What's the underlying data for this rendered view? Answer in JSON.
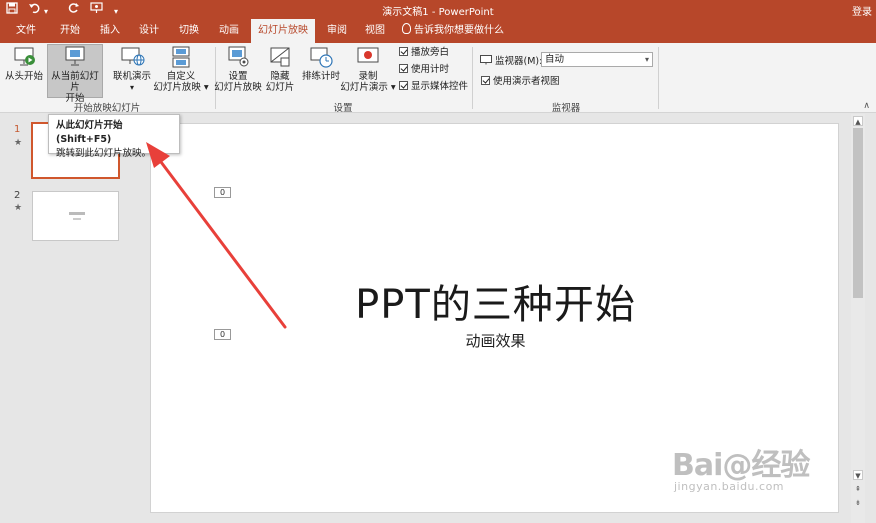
{
  "titlebar": {
    "title": "演示文稿1  -  PowerPoint",
    "login": "登录",
    "quick_access": {
      "save": "save-icon",
      "undo": "undo-icon",
      "redo": "redo-icon",
      "from_start": "from-start-icon",
      "customize": "▾"
    }
  },
  "tabs": [
    {
      "label": "文件"
    },
    {
      "label": "开始"
    },
    {
      "label": "插入"
    },
    {
      "label": "设计"
    },
    {
      "label": "切换"
    },
    {
      "label": "动画"
    },
    {
      "label": "幻灯片放映"
    },
    {
      "label": "审阅"
    },
    {
      "label": "视图"
    }
  ],
  "tell_me": "告诉我你想要做什么",
  "ribbon": {
    "start_slideshow_group": {
      "label": "开始放映幻灯片",
      "from_beginning": "从头开始",
      "from_current_line1": "从当前幻灯片",
      "from_current_line2": "开始",
      "online_line1": "联机演示",
      "custom_line1": "自定义",
      "custom_line2": "幻灯片放映 ▾"
    },
    "setup_group": {
      "label": "设置",
      "setup_line1": "设置",
      "setup_line2": "幻灯片放映",
      "hide_line1": "隐藏",
      "hide_line2": "幻灯片",
      "rehearse": "排练计时",
      "record_line1": "录制",
      "record_line2": "幻灯片演示 ▾",
      "play_narrations": "播放旁白",
      "use_timings": "使用计时",
      "show_media_controls": "显示媒体控件"
    },
    "monitors_group": {
      "label": "监视器",
      "monitor_label": "监视器(M):",
      "monitor_value": "自动",
      "use_presenter_view": "使用演示者视图"
    }
  },
  "tooltip": {
    "title": "从此幻灯片开始 (Shift+F5)",
    "description": "跳转到此幻灯片放映。"
  },
  "thumbnails": [
    {
      "number": "1",
      "star": "★"
    },
    {
      "number": "2",
      "star": "★"
    }
  ],
  "slide": {
    "title": "PPT的三种开始",
    "subtitle": "动画效果",
    "anim_tags": [
      "0",
      "0"
    ]
  },
  "watermark": {
    "brand": "Bai@经验",
    "site": "jingyan.baidu.com"
  },
  "colors": {
    "accent": "#b7472a",
    "arrow": "#e8403a"
  }
}
